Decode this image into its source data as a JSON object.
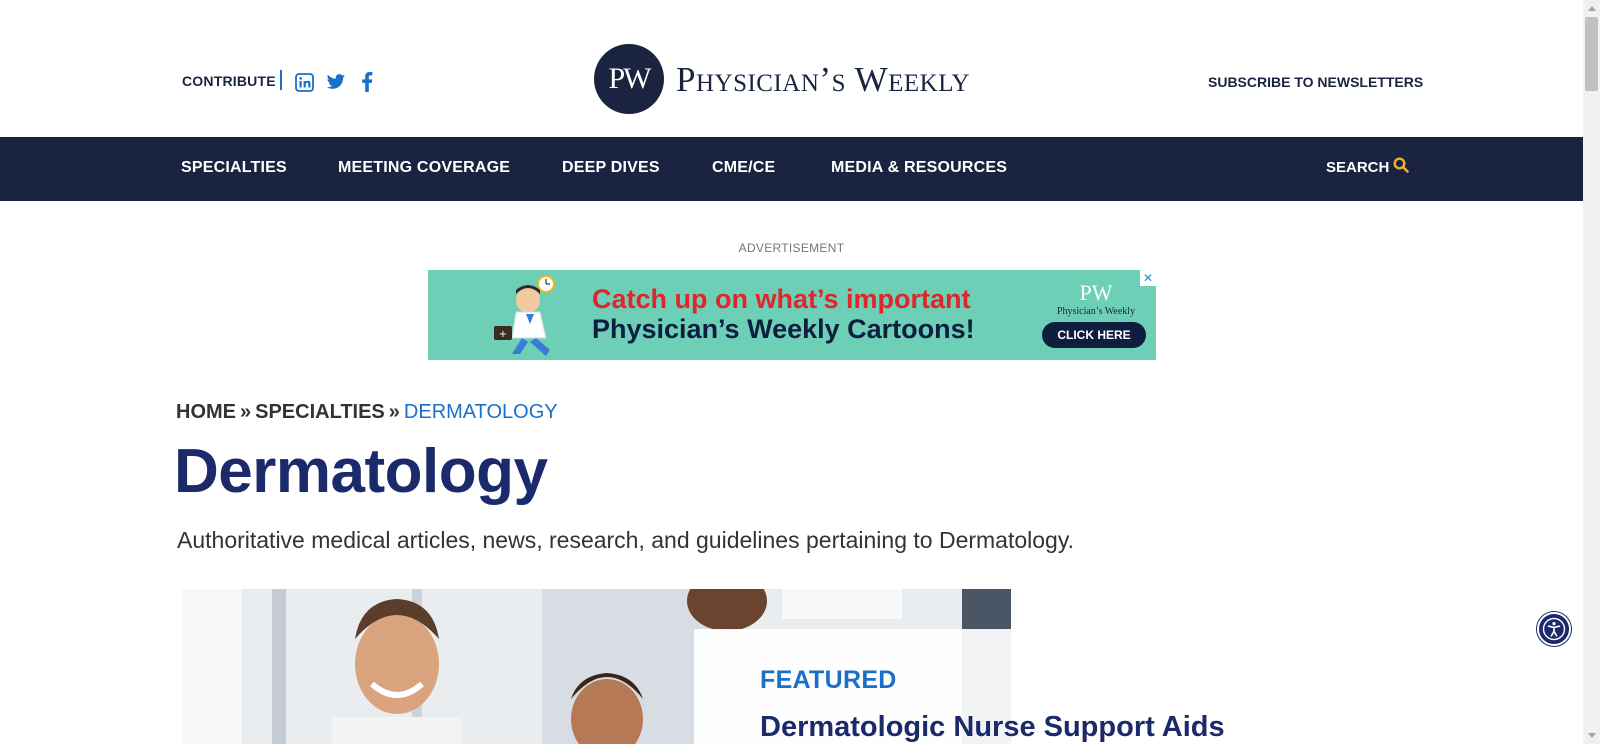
{
  "header": {
    "contribute_label": "CONTRIBUTE",
    "logo_monogram": "PW",
    "logo_text": "Physician’s Weekly",
    "subscribe_label": "SUBSCRIBE TO NEWSLETTERS",
    "social_icons": [
      "linkedin-icon",
      "twitter-icon",
      "facebook-icon"
    ]
  },
  "nav": {
    "items": [
      {
        "label": "SPECIALTIES"
      },
      {
        "label": "MEETING COVERAGE"
      },
      {
        "label": "DEEP DIVES"
      },
      {
        "label": "CME/CE"
      },
      {
        "label": "MEDIA & RESOURCES"
      }
    ],
    "search_label": "SEARCH"
  },
  "ad": {
    "label": "ADVERTISEMENT",
    "line1": "Catch up on what’s important",
    "line2": "Physician’s Weekly Cartoons!",
    "logo_monogram": "PW",
    "logo_name": "Physician’s Weekly",
    "cta_label": "CLICK HERE",
    "close_symbol": "✕"
  },
  "breadcrumb": {
    "items": [
      "HOME",
      "SPECIALTIES",
      "DERMATOLOGY"
    ],
    "separator": "»"
  },
  "page": {
    "title": "Dermatology",
    "description": "Authoritative medical articles, news, research, and guidelines pertaining to Dermatology."
  },
  "featured": {
    "label": "FEATURED",
    "title": "Dermatologic Nurse Support Aids"
  },
  "colors": {
    "navy": "#1a2440",
    "title_navy": "#1a2a6a",
    "accent_blue": "#1a6fc9",
    "search_gold": "#f0b323",
    "ad_teal": "#6dcfb6",
    "ad_red": "#e0252b"
  }
}
